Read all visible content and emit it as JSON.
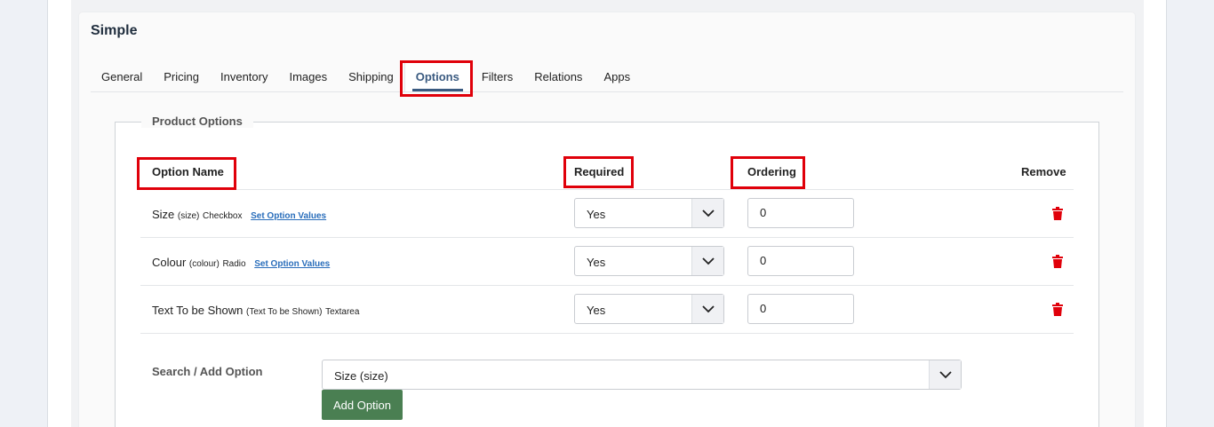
{
  "card": {
    "title": "Simple"
  },
  "tabs": [
    "General",
    "Pricing",
    "Inventory",
    "Images",
    "Shipping",
    "Options",
    "Filters",
    "Relations",
    "Apps"
  ],
  "active_tab": "Options",
  "section": {
    "legend": "Product Options"
  },
  "columns": {
    "name": "Option Name",
    "required": "Required",
    "ordering": "Ordering",
    "remove": "Remove"
  },
  "rows": [
    {
      "label": "Size",
      "code": "(size)",
      "type": "Checkbox",
      "link": "Set Option Values",
      "required": "Yes",
      "ordering": "0"
    },
    {
      "label": "Colour",
      "code": "(colour)",
      "type": "Radio",
      "link": "Set Option Values",
      "required": "Yes",
      "ordering": "0"
    },
    {
      "label": "Text To be Shown",
      "code": "(Text To be Shown)",
      "type": "Textarea",
      "link": "",
      "required": "Yes",
      "ordering": "0"
    }
  ],
  "search": {
    "label": "Search / Add Option",
    "selected": "Size (size)",
    "add_label": "Add Option"
  },
  "icons": {
    "dropdown": "chevron-down-icon",
    "remove": "trash-icon"
  },
  "colors": {
    "highlight": "#e0000a",
    "remove": "#e0000a",
    "add_button": "#4a7f52",
    "active_tab": "#3a5a80"
  }
}
